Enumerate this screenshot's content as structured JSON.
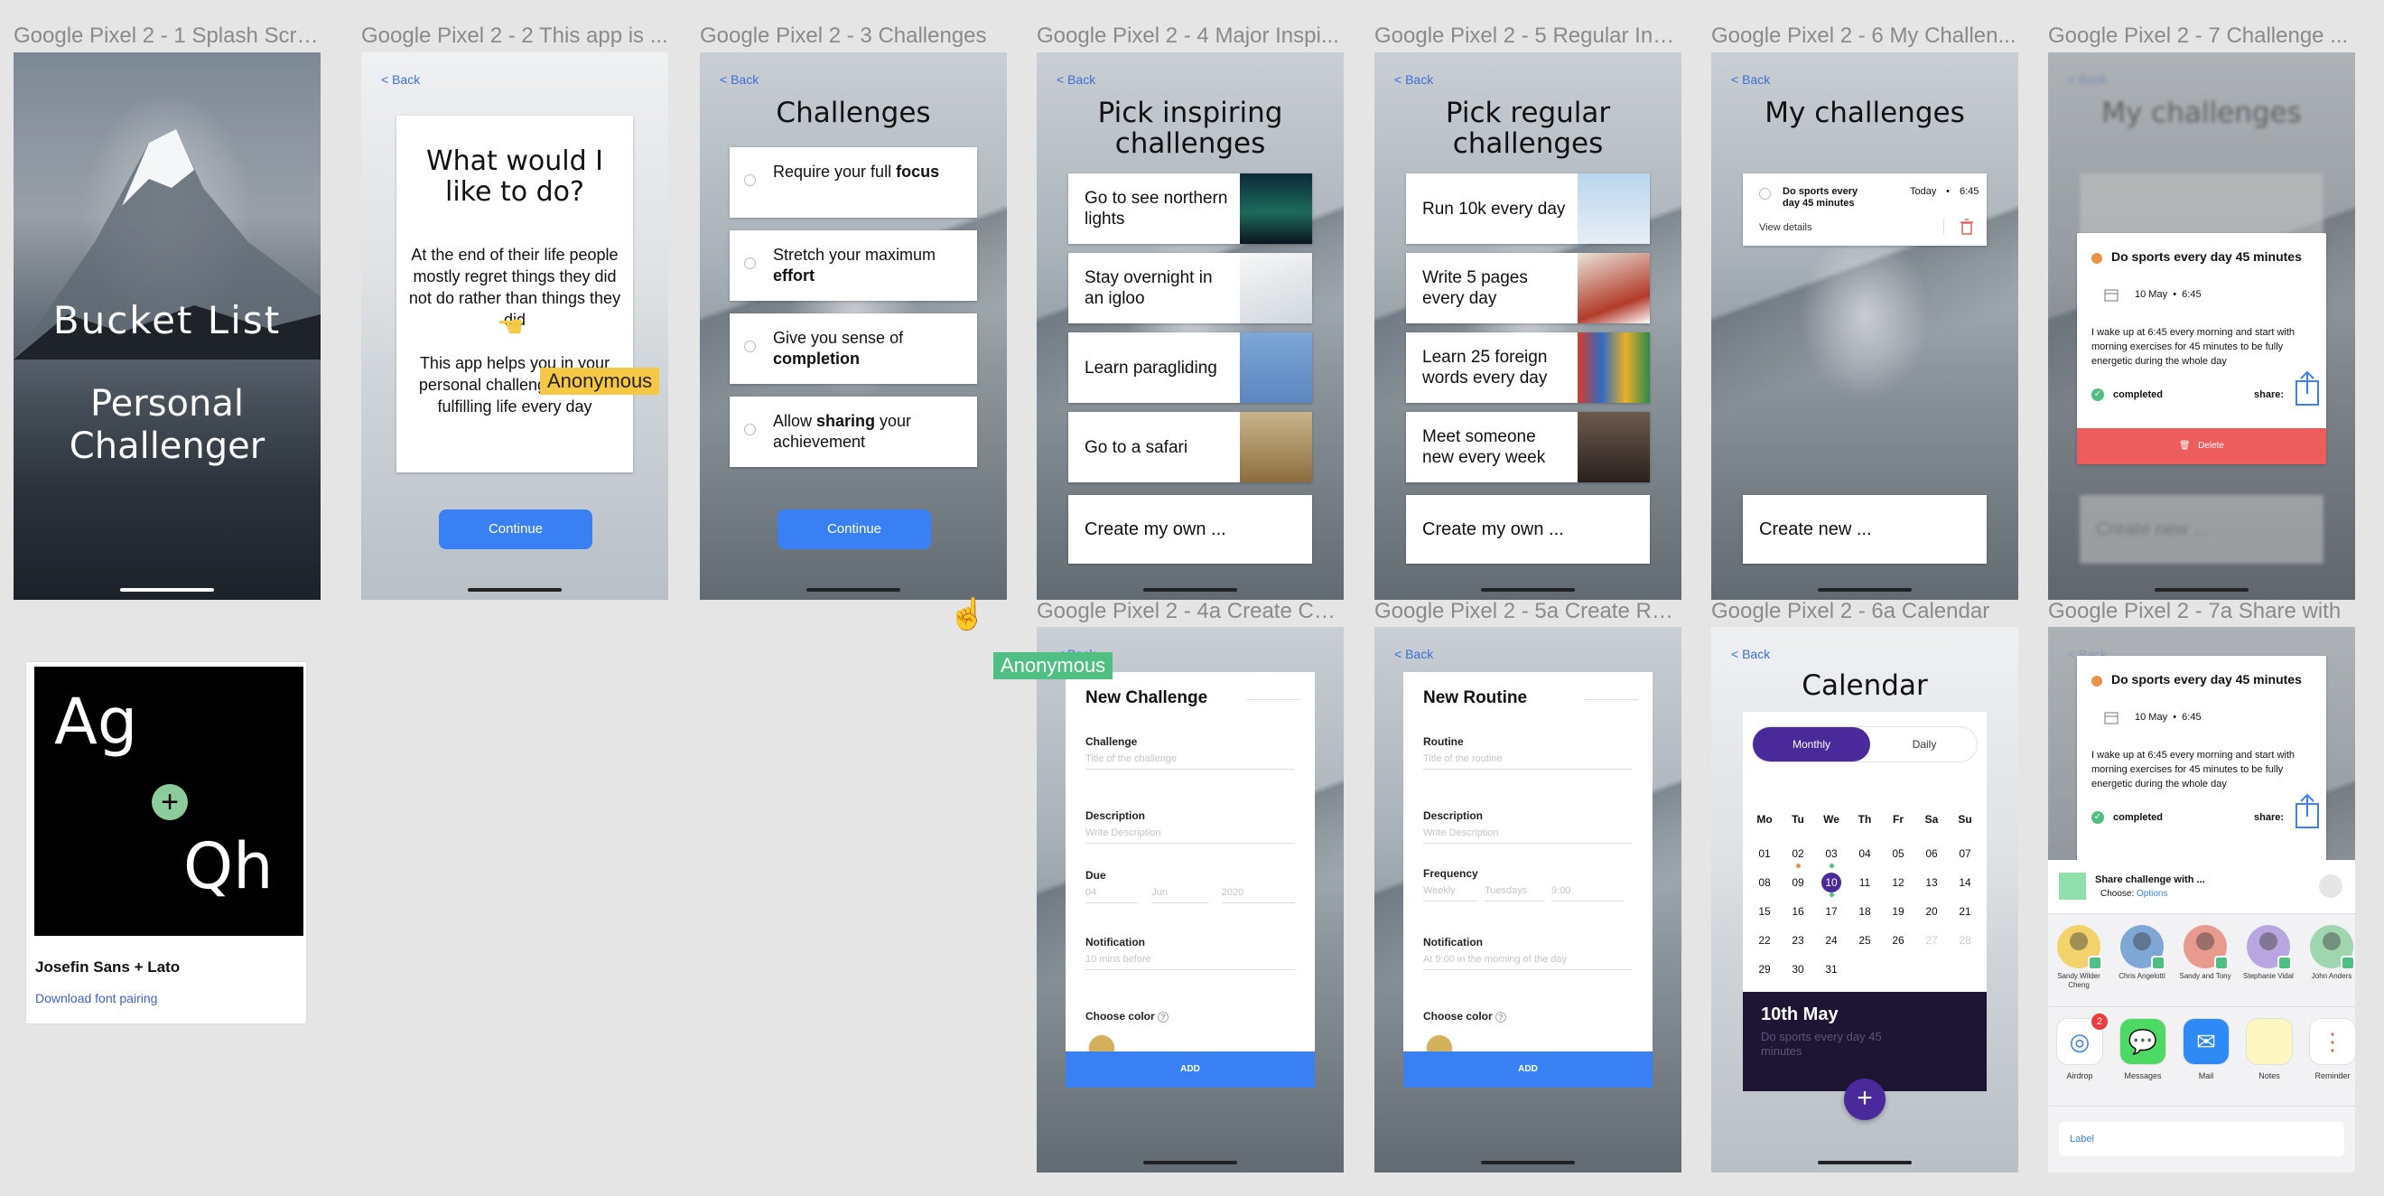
{
  "labels": {
    "f1": "Google Pixel 2 - 1 Splash Scre...",
    "f2": "Google Pixel 2 - 2 This app is ...",
    "f3": "Google Pixel 2 - 3 Challenges",
    "f4": "Google Pixel 2 - 4 Major Inspi...",
    "f5": "Google Pixel 2 - 5 Regular Ins...",
    "f6": "Google Pixel 2 - 6 My Challen...",
    "f7": "Google Pixel 2 - 7 Challenge ...",
    "f4a": "Google Pixel 2 - 4a Create Ch...",
    "f5a": "Google Pixel 2 - 5a Create Ro...",
    "f6a": "Google Pixel 2 - 6a Calendar",
    "f7a": "Google Pixel 2 - 7a Share with"
  },
  "common": {
    "back": "< Back",
    "continue": "Continue"
  },
  "splash": {
    "title": "Bucket List",
    "subtitle_1": "Personal",
    "subtitle_2": "Challenger"
  },
  "intro": {
    "title_1": "What would I",
    "title_2": "like to do?",
    "para1": "At the end of their life people mostly regret things they did not do rather than things they did",
    "para2": "This app helps you in your personal challenges to live fulfilling life every day"
  },
  "challenges": {
    "title": "Challenges",
    "items": [
      {
        "pre": "Require your full ",
        "bold": "focus",
        "post": ""
      },
      {
        "pre": "Stretch your maximum ",
        "bold": "effort",
        "post": ""
      },
      {
        "pre": "Give you sense of ",
        "bold": "completion",
        "post": ""
      },
      {
        "pre": "Allow ",
        "bold": "sharing",
        "post": " your achievement"
      }
    ]
  },
  "inspiring": {
    "title_1": "Pick inspiring",
    "title_2": "challenges",
    "items": [
      "Go to see northern lights",
      "Stay overnight in an igloo",
      "Learn paragliding",
      "Go to a safari"
    ],
    "create": "Create my own ..."
  },
  "regular": {
    "title_1": "Pick regular",
    "title_2": "challenges",
    "items": [
      "Run 10k every day",
      "Write 5 pages every day",
      "Learn 25 foreign words every day",
      "Meet someone new every week"
    ],
    "create": "Create my own ..."
  },
  "my_challenges": {
    "title": "My challenges",
    "item": "Do sports every day 45 minutes",
    "when": "Today",
    "time": "6:45",
    "view_details": "View details",
    "create": "Create new ..."
  },
  "detail": {
    "title": "Do sports every day 45 minutes",
    "date": "10 May",
    "time": "6:45",
    "desc": "I wake up at 6:45 every morning and start with morning exercises for 45 minutes to be fully energetic during the whole day",
    "status": "completed",
    "share": "share:",
    "delete": "Delete"
  },
  "new_challenge": {
    "title": "New Challenge",
    "challenge_label": "Challenge",
    "challenge_ph": "Title of the challenge",
    "desc_label": "Description",
    "desc_ph": "Write Description",
    "due_label": "Due",
    "due_d": "04",
    "due_m": "Jun",
    "due_y": "2020",
    "notif_label": "Notification",
    "notif_ph": "10 mins before",
    "color_label": "Choose color",
    "add": "ADD"
  },
  "new_routine": {
    "title": "New Routine",
    "routine_label": "Routine",
    "routine_ph": "Title of the routine",
    "desc_label": "Description",
    "desc_ph": "Write Description",
    "freq_label": "Frequency",
    "freq_1": "Weekly",
    "freq_2": "Tuesdays",
    "freq_3": "9:00",
    "notif_label": "Notification",
    "notif_ph": "At 9:00 in the morning of the day",
    "color_label": "Choose color",
    "add": "ADD"
  },
  "calendar": {
    "title": "Calendar",
    "tab_monthly": "Monthly",
    "tab_daily": "Daily",
    "weekdays": [
      "Mo",
      "Tu",
      "We",
      "Th",
      "Fr",
      "Sa",
      "Su"
    ],
    "weeks": [
      [
        "01",
        "02",
        "03",
        "04",
        "05",
        "06",
        "07"
      ],
      [
        "08",
        "09",
        "10",
        "11",
        "12",
        "13",
        "14"
      ],
      [
        "15",
        "16",
        "17",
        "18",
        "19",
        "20",
        "21"
      ],
      [
        "22",
        "23",
        "24",
        "25",
        "26",
        "27",
        "28"
      ],
      [
        "29",
        "30",
        "31",
        "",
        "",
        "",
        ""
      ]
    ],
    "selected": "10",
    "day_title": "10th May",
    "day_event": "Do sports every day 45 minutes"
  },
  "share_sheet": {
    "title": "Share challenge with ...",
    "choose": "Choose:",
    "options": "Options",
    "contacts": [
      "Sandy Wilder Cheng",
      "Chris Angelotti",
      "Sandy and Tony",
      "Stephanie Vidal",
      "John Anders"
    ],
    "apps": [
      "Airdrop",
      "Messages",
      "Mail",
      "Notes",
      "Reminder"
    ],
    "airdrop_badge": "2",
    "label": "Label"
  },
  "font_card": {
    "sample_1": "Ag",
    "sample_2": "Qh",
    "plus": "+",
    "name": "Josefin Sans + Lato",
    "link": "Download font pairing"
  },
  "cursors": {
    "tag": "Anonymous"
  },
  "colors": {
    "accent": "#3a80f5",
    "cursor_yellow": "#f7c843",
    "cursor_green": "#4fbf83",
    "calendar_dark": "#1e1535",
    "calendar_purple": "#4a2a9a",
    "delete_red": "#ee5d5d",
    "color_dot": "#d3b15b"
  }
}
